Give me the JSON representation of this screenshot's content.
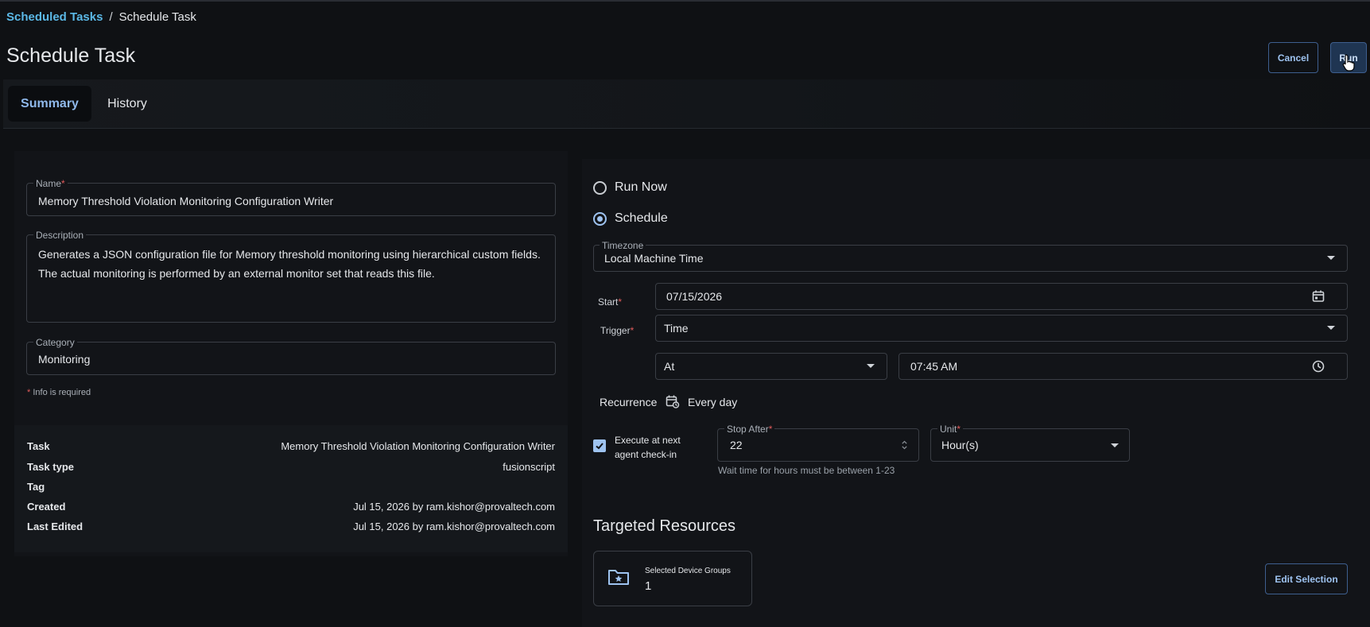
{
  "breadcrumb": {
    "parent": "Scheduled Tasks",
    "separator": "/",
    "current": "Schedule Task"
  },
  "header": {
    "title": "Schedule Task",
    "cancel_label": "Cancel",
    "run_label": "Run"
  },
  "tabs": [
    {
      "label": "Summary",
      "active": true
    },
    {
      "label": "History",
      "active": false
    }
  ],
  "form": {
    "name": {
      "label": "Name",
      "required_mark": "*",
      "value": "Memory Threshold Violation Monitoring Configuration Writer"
    },
    "description": {
      "label": "Description",
      "value": "Generates a JSON configuration file for Memory threshold monitoring using hierarchical custom fields. The actual monitoring is performed by an external monitor set that reads this file."
    },
    "category": {
      "label": "Category",
      "value": "Monitoring"
    },
    "required_note_mark": "*",
    "required_note": "Info is required"
  },
  "details": [
    {
      "label": "Task",
      "value": "Memory Threshold Violation Monitoring Configuration Writer"
    },
    {
      "label": "Task type",
      "value": "fusionscript"
    },
    {
      "label": "Tag",
      "value": ""
    },
    {
      "label": "Created",
      "value": "Jul 15, 2026 by ram.kishor@provaltech.com"
    },
    {
      "label": "Last Edited",
      "value": "Jul 15, 2026 by ram.kishor@provaltech.com"
    }
  ],
  "schedule": {
    "run_now_label": "Run Now",
    "schedule_label": "Schedule",
    "selected": "schedule",
    "timezone": {
      "label": "Timezone",
      "value": "Local Machine Time"
    },
    "start": {
      "label": "Start",
      "required_mark": "*",
      "value": "07/15/2026"
    },
    "trigger": {
      "label": "Trigger",
      "required_mark": "*",
      "value": "Time"
    },
    "at": {
      "value": "At"
    },
    "time": {
      "value": "07:45 AM"
    },
    "recurrence": {
      "label": "Recurrence",
      "value": "Every day"
    },
    "execute_next": {
      "label_line1": "Execute at next",
      "label_line2": "agent check-in",
      "checked": true
    },
    "stop_after": {
      "label": "Stop After",
      "required_mark": "*",
      "value": "22"
    },
    "unit": {
      "label": "Unit",
      "required_mark": "*",
      "value": "Hour(s)"
    },
    "help": "Wait time for hours must be between 1-23"
  },
  "targeted": {
    "title": "Targeted Resources",
    "card_label": "Selected Device Groups",
    "card_count": "1",
    "edit_label": "Edit Selection"
  },
  "colors": {
    "accent": "#9ec3f0",
    "link": "#5bb8e6",
    "required": "#e15b5b",
    "background": "#0f1114"
  },
  "icons": [
    "calendar-icon",
    "clock-icon",
    "calendar-repeat-icon",
    "folder-star-icon",
    "chevron-down-icon",
    "check-icon",
    "stepper-icon",
    "pointer-cursor-icon"
  ]
}
